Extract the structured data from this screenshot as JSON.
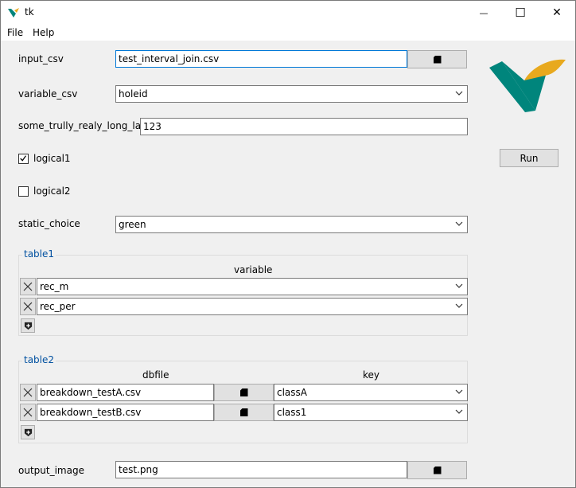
{
  "window": {
    "title": "tk",
    "minimize_glyph": "—",
    "maximize_glyph": "☐",
    "close_glyph": "✕"
  },
  "menu": [
    "File",
    "Help"
  ],
  "colors": {
    "accent": "#0078d7",
    "logo_teal": "#00857c",
    "logo_yellow": "#e8a91e",
    "group_title": "#0050a0"
  },
  "fields": {
    "input_csv": {
      "label": "input_csv",
      "value": "test_interval_join.csv"
    },
    "variable_csv": {
      "label": "variable_csv",
      "value": "holeid"
    },
    "long_label": {
      "label": "some_trully_realy_long_label",
      "value": "123"
    },
    "logical1": {
      "label": "logical1",
      "checked": true
    },
    "logical2": {
      "label": "logical2",
      "checked": false
    },
    "static_choice": {
      "label": "static_choice",
      "value": "green"
    },
    "output_image": {
      "label": "output_image",
      "value": "test.png"
    }
  },
  "run_button": "Run",
  "table1": {
    "title": "table1",
    "columns": [
      "variable"
    ],
    "rows": [
      {
        "variable": "rec_m"
      },
      {
        "variable": "rec_per"
      }
    ]
  },
  "table2": {
    "title": "table2",
    "columns": [
      "dbfile",
      "key"
    ],
    "rows": [
      {
        "dbfile": "breakdown_testA.csv",
        "key": "classA"
      },
      {
        "dbfile": "breakdown_testB.csv",
        "key": "class1"
      }
    ]
  },
  "icons": {
    "browse": "file-browse-icon",
    "remove": "close-x-icon",
    "add": "plus-shield-icon",
    "dropdown": "chevron-down-icon",
    "logo": "vale-logo-icon"
  }
}
